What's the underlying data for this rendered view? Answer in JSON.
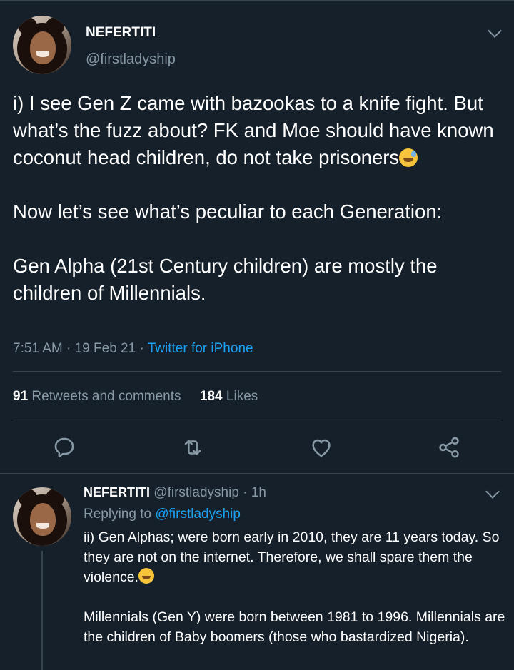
{
  "main_tweet": {
    "author_name": "NEFERTITI",
    "author_handle": "@firstladyship",
    "text_part1": "i) I see Gen Z came with bazookas to a knife fight. But what’s the fuzz about? FK and Moe should have known coconut head children, do not take prisoners",
    "text_part2": "\n\nNow let’s see what’s peculiar to each Generation:\n\nGen Alpha (21st Century children) are mostly the children of Millennials.",
    "emoji_1": "sweat-smile-emoji",
    "time": "7:51 AM",
    "date": "19 Feb 21",
    "dot": "·",
    "source": "Twitter for iPhone",
    "retweets_count": "91",
    "retweets_label": "Retweets and comments",
    "likes_count": "184",
    "likes_label": "Likes"
  },
  "actions": {
    "reply_icon": "reply-icon",
    "retweet_icon": "retweet-icon",
    "like_icon": "heart-icon",
    "share_icon": "share-icon"
  },
  "reply_tweet": {
    "author_name": "NEFERTITI",
    "author_handle": "@firstladyship",
    "age": "1h",
    "dot": "·",
    "replying_label": "Replying to",
    "replying_to": "@firstladyship",
    "text_part1": "ii) Gen Alphas; were born early in 2010, they are 11 years today. So they are not on the internet. Therefore, we shall spare them the violence.",
    "text_part2": "\n\nMillennials (Gen Y) were born between 1981 to 1996. Millennials are the children of Baby boomers (those who bastardized Nigeria).",
    "emoji_1": "smiling-face-emoji"
  },
  "colors": {
    "background": "#15202b",
    "accent": "#1da1f2",
    "secondary_text": "#8899a6",
    "divider": "#38444d"
  }
}
